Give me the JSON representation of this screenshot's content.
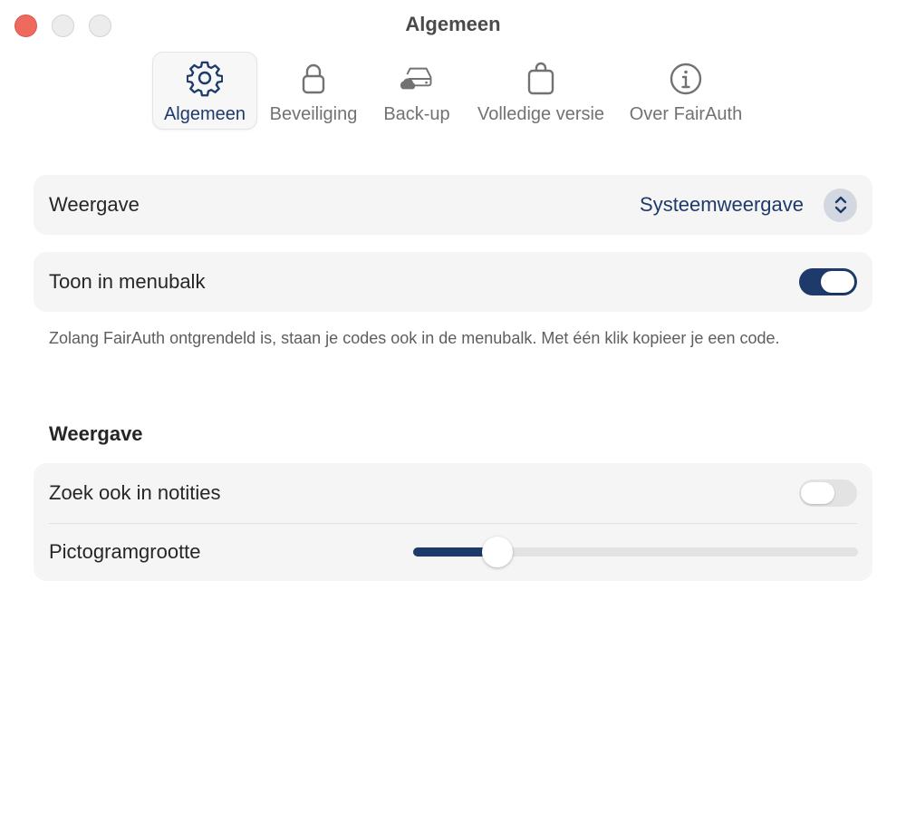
{
  "window": {
    "title": "Algemeen"
  },
  "toolbar": {
    "tabs": [
      {
        "label": "Algemeen",
        "icon": "gear-icon",
        "active": true
      },
      {
        "label": "Beveiliging",
        "icon": "lock-icon",
        "active": false
      },
      {
        "label": "Back-up",
        "icon": "cloud-drive-icon",
        "active": false
      },
      {
        "label": "Volledige versie",
        "icon": "shopping-bag-icon",
        "active": false
      },
      {
        "label": "Over FairAuth",
        "icon": "info-icon",
        "active": false
      }
    ]
  },
  "appearance": {
    "label": "Weergave",
    "value": "Systeemweergave"
  },
  "menubar": {
    "label": "Toon in menubalk",
    "enabled": true,
    "help": "Zolang FairAuth ontgrendeld is, staan je codes ook in de menubalk. Met één klik kopieer je een code."
  },
  "display_section": {
    "title": "Weergave",
    "search_notes": {
      "label": "Zoek ook in notities",
      "enabled": false
    },
    "icon_size": {
      "label": "Pictogramgrootte",
      "value_fraction": 0.19
    }
  },
  "colors": {
    "accent": "#1e3a6b",
    "close_button": "#ee6a5f"
  }
}
